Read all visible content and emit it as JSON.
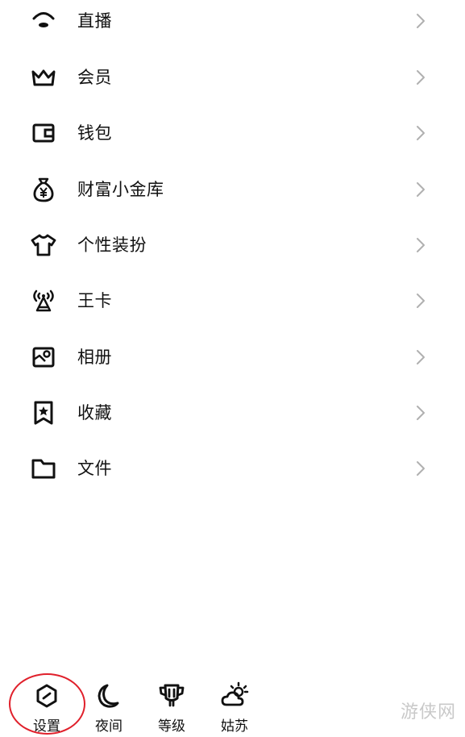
{
  "menu": {
    "items": [
      {
        "label": "直播",
        "icon": "live-icon"
      },
      {
        "label": "会员",
        "icon": "crown-icon"
      },
      {
        "label": "钱包",
        "icon": "wallet-icon"
      },
      {
        "label": "财富小金库",
        "icon": "money-bag-icon"
      },
      {
        "label": "个性装扮",
        "icon": "tshirt-icon"
      },
      {
        "label": "王卡",
        "icon": "signal-tower-icon"
      },
      {
        "label": "相册",
        "icon": "photo-album-icon"
      },
      {
        "label": "收藏",
        "icon": "bookmark-star-icon"
      },
      {
        "label": "文件",
        "icon": "folder-icon"
      }
    ]
  },
  "bottom_bar": {
    "settings": "设置",
    "night": "夜间",
    "level": "等级",
    "weather": "姑苏"
  },
  "watermark": "游侠网",
  "colors": {
    "text": "#111111",
    "chevron": "#b0b0b0",
    "highlight": "#e0202b"
  }
}
